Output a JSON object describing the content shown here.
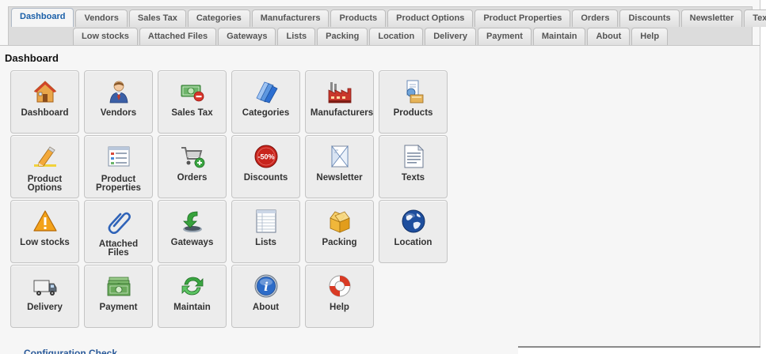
{
  "tabs_row1": [
    {
      "label": "Dashboard",
      "active": true
    },
    {
      "label": "Vendors"
    },
    {
      "label": "Sales Tax"
    },
    {
      "label": "Categories"
    },
    {
      "label": "Manufacturers"
    },
    {
      "label": "Products"
    },
    {
      "label": "Product Options"
    },
    {
      "label": "Product Properties"
    },
    {
      "label": "Orders"
    },
    {
      "label": "Discounts"
    },
    {
      "label": "Newsletter"
    },
    {
      "label": "Texts"
    }
  ],
  "tabs_row2": [
    {
      "label": "Low stocks"
    },
    {
      "label": "Attached Files"
    },
    {
      "label": "Gateways"
    },
    {
      "label": "Lists"
    },
    {
      "label": "Packing"
    },
    {
      "label": "Location"
    },
    {
      "label": "Delivery"
    },
    {
      "label": "Payment"
    },
    {
      "label": "Maintain"
    },
    {
      "label": "About"
    },
    {
      "label": "Help"
    }
  ],
  "page_title": "Dashboard",
  "tiles": [
    {
      "line1": "Dashboard",
      "icon": "home-icon"
    },
    {
      "line1": "Vendors",
      "icon": "vendor-person-icon"
    },
    {
      "line1": "Sales Tax",
      "icon": "money-minus-icon"
    },
    {
      "line1": "Categories",
      "icon": "folders-icon"
    },
    {
      "line1": "Manufacturers",
      "icon": "factory-icon"
    },
    {
      "line1": "Products",
      "icon": "products-icon"
    },
    {
      "line1": "Product",
      "line2": "Options",
      "icon": "pencil-highlight-icon"
    },
    {
      "line1": "Product",
      "line2": "Properties",
      "icon": "properties-form-icon"
    },
    {
      "line1": "Orders",
      "icon": "cart-add-icon"
    },
    {
      "line1": "Discounts",
      "icon": "discount-badge-icon"
    },
    {
      "line1": "Newsletter",
      "icon": "newsletter-icon"
    },
    {
      "line1": "Texts",
      "icon": "text-document-icon"
    },
    {
      "line1": "Low stocks",
      "icon": "warning-icon"
    },
    {
      "line1": "Attached",
      "line2": "Files",
      "icon": "paperclip-icon"
    },
    {
      "line1": "Gateways",
      "icon": "gateway-arrow-icon"
    },
    {
      "line1": "Lists",
      "icon": "list-sheet-icon"
    },
    {
      "line1": "Packing",
      "icon": "box-icon"
    },
    {
      "line1": "Location",
      "icon": "globe-icon"
    },
    {
      "line1": "Delivery",
      "icon": "truck-icon"
    },
    {
      "line1": "Payment",
      "icon": "banknotes-icon"
    },
    {
      "line1": "Maintain",
      "icon": "refresh-icon"
    },
    {
      "line1": "About",
      "icon": "info-icon"
    },
    {
      "line1": "Help",
      "icon": "lifebuoy-icon"
    }
  ],
  "config_section_title": "Configuration Check",
  "colors": {
    "active_tab_text": "#1a5fa8",
    "tile_bg": "#ececec",
    "link_blue": "#2a5a9a"
  }
}
